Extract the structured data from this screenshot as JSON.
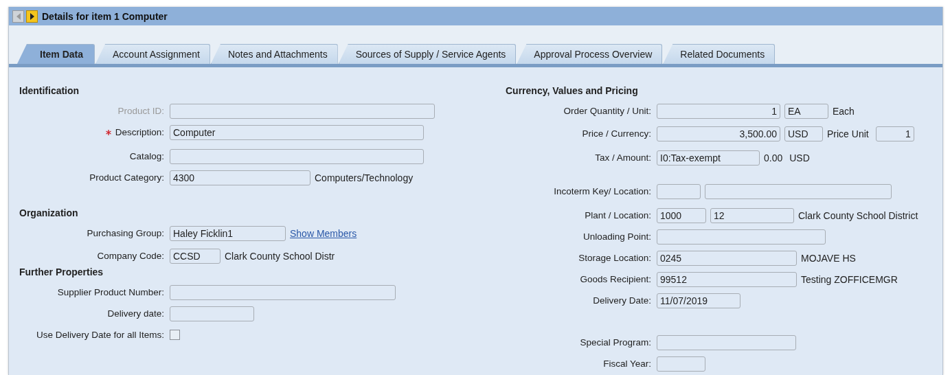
{
  "window": {
    "title": "Details for item 1 Computer",
    "prev_enabled": false,
    "next_enabled": true
  },
  "tabs": [
    {
      "label": "Item Data",
      "selected": true
    },
    {
      "label": "Account Assignment",
      "selected": false
    },
    {
      "label": "Notes and Attachments",
      "selected": false
    },
    {
      "label": "Sources of Supply / Service Agents",
      "selected": false
    },
    {
      "label": "Approval Process Overview",
      "selected": false
    },
    {
      "label": "Related Documents",
      "selected": false
    }
  ],
  "columns": [
    {
      "sections": [
        {
          "heading": "Identification",
          "rows": [
            {
              "label": "Product ID:",
              "disabled": true,
              "required": false,
              "parts": [
                {
                  "kind": "field"
                }
              ]
            },
            {
              "label": "Description:",
              "disabled": false,
              "required": true,
              "parts": [
                {
                  "kind": "field",
                  "value": "Computer"
                }
              ]
            },
            {
              "label": "Catalog:",
              "disabled": false,
              "required": false,
              "parts": [
                {
                  "kind": "field"
                }
              ]
            },
            {
              "label": "Product Category:",
              "disabled": false,
              "required": false,
              "parts": [
                {
                  "kind": "field",
                  "value": "4300"
                },
                {
                  "kind": "text",
                  "value": "Computers/Technology"
                }
              ]
            }
          ]
        },
        {
          "heading": "Organization",
          "rows": [
            {
              "label": "Purchasing Group:",
              "disabled": false,
              "required": false,
              "parts": [
                {
                  "kind": "field",
                  "value": "Haley Ficklin1"
                },
                {
                  "kind": "link",
                  "value": "Show Members"
                }
              ]
            },
            {
              "label": "Company Code:",
              "disabled": false,
              "required": false,
              "parts": [
                {
                  "kind": "field",
                  "value": "CCSD"
                },
                {
                  "kind": "text",
                  "value": "Clark County School Distr"
                }
              ]
            }
          ]
        },
        {
          "heading": "Further Properties",
          "rows": [
            {
              "label": "Supplier Product Number:",
              "disabled": false,
              "required": false,
              "parts": [
                {
                  "kind": "field"
                }
              ]
            },
            {
              "label": "Delivery date:",
              "disabled": false,
              "required": false,
              "parts": [
                {
                  "kind": "field"
                }
              ]
            },
            {
              "label": "Use Delivery Date for all Items:",
              "disabled": false,
              "required": false,
              "parts": [
                {
                  "kind": "checkbox",
                  "checked": false
                }
              ]
            }
          ]
        }
      ]
    },
    {
      "sections": [
        {
          "heading": "Currency, Values and Pricing",
          "rows": [
            {
              "label": "Order Quantity / Unit:",
              "disabled": false,
              "required": false,
              "parts": [
                {
                  "kind": "number_field",
                  "value": "1"
                },
                {
                  "kind": "field",
                  "value": "EA"
                },
                {
                  "kind": "text",
                  "value": "Each"
                }
              ]
            },
            {
              "label": "Price / Currency:",
              "disabled": false,
              "required": false,
              "parts": [
                {
                  "kind": "number_field",
                  "value": "3,500.00"
                },
                {
                  "kind": "field",
                  "value": "USD"
                },
                {
                  "kind": "text",
                  "value": "Price Unit"
                },
                {
                  "kind": "number_field",
                  "value": "1"
                }
              ]
            },
            {
              "label": "Tax / Amount:",
              "disabled": false,
              "required": false,
              "parts": [
                {
                  "kind": "field",
                  "value": "I0:Tax-exempt"
                },
                {
                  "kind": "text",
                  "value": "0.00"
                },
                {
                  "kind": "text",
                  "value": "USD"
                }
              ]
            },
            {
              "label": "Incoterm Key/ Location:",
              "disabled": false,
              "required": false,
              "parts": [
                {
                  "kind": "field"
                },
                {
                  "kind": "field"
                }
              ]
            },
            {
              "label": "Plant / Location:",
              "disabled": false,
              "required": false,
              "parts": [
                {
                  "kind": "field",
                  "value": "1000"
                },
                {
                  "kind": "field",
                  "value": "12"
                },
                {
                  "kind": "text",
                  "value": "Clark County School District"
                }
              ]
            },
            {
              "label": "Unloading Point:",
              "disabled": false,
              "required": false,
              "parts": [
                {
                  "kind": "field"
                }
              ]
            },
            {
              "label": "Storage Location:",
              "disabled": false,
              "required": false,
              "parts": [
                {
                  "kind": "field",
                  "value": "0245"
                },
                {
                  "kind": "text",
                  "value": "MOJAVE HS"
                }
              ]
            },
            {
              "label": "Goods Recipient:",
              "disabled": false,
              "required": false,
              "parts": [
                {
                  "kind": "field",
                  "value": "99512"
                },
                {
                  "kind": "text",
                  "value": "Testing ZOFFICEMGR"
                }
              ]
            },
            {
              "label": "Delivery Date:",
              "disabled": false,
              "required": false,
              "parts": [
                {
                  "kind": "field",
                  "value": "11/07/2019"
                }
              ]
            },
            {
              "label": "Special Program:",
              "disabled": false,
              "required": false,
              "parts": [
                {
                  "kind": "field"
                }
              ]
            },
            {
              "label": "Fiscal Year:",
              "disabled": false,
              "required": false,
              "parts": [
                {
                  "kind": "field"
                }
              ]
            }
          ]
        }
      ]
    }
  ]
}
